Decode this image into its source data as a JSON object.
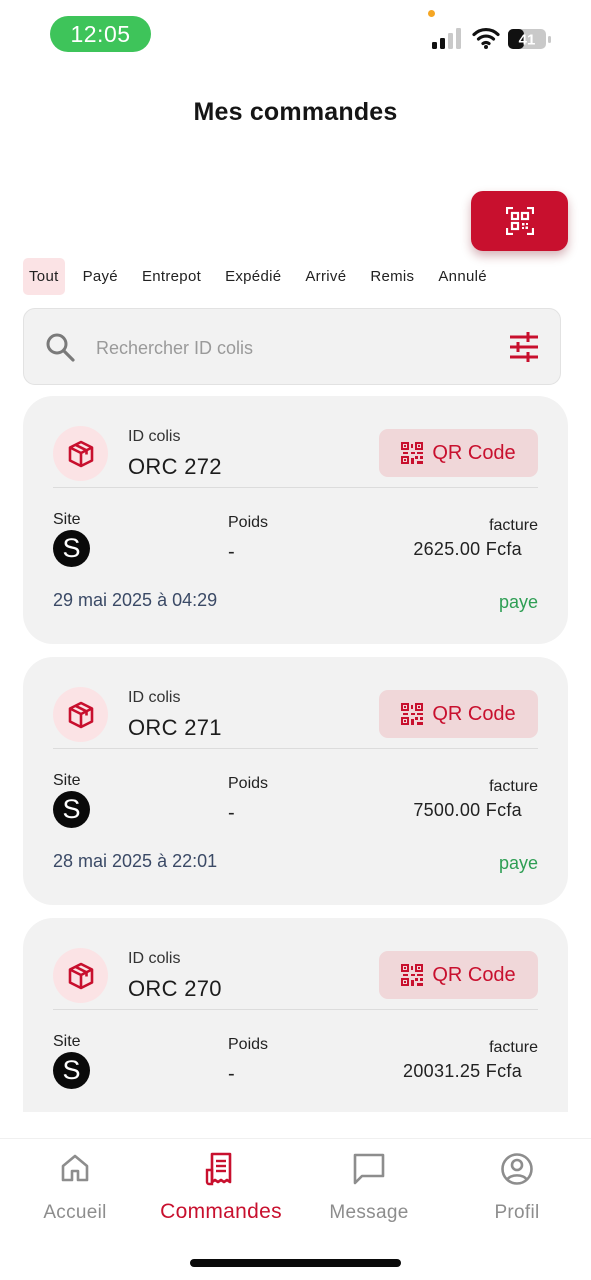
{
  "status_bar": {
    "time": "12:05",
    "battery": "41"
  },
  "header": {
    "title": "Mes commandes"
  },
  "tabs": [
    {
      "label": "Tout",
      "active": true
    },
    {
      "label": "Payé",
      "active": false
    },
    {
      "label": "Entrepot",
      "active": false
    },
    {
      "label": "Expédié",
      "active": false
    },
    {
      "label": "Arrivé",
      "active": false
    },
    {
      "label": "Remis",
      "active": false
    },
    {
      "label": "Annulé",
      "active": false
    }
  ],
  "search": {
    "placeholder": "Rechercher ID colis",
    "value": ""
  },
  "orders": [
    {
      "id_label": "ID colis",
      "id": "ORC 272",
      "qr_label": "QR Code",
      "site_label": "Site",
      "site_logo": "S",
      "poids_label": "Poids",
      "poids": "-",
      "facture_label": "facture",
      "facture": "2625.00 Fcfa",
      "date": "29 mai 2025 à 04:29",
      "status": "paye"
    },
    {
      "id_label": "ID colis",
      "id": "ORC 271",
      "qr_label": "QR Code",
      "site_label": "Site",
      "site_logo": "S",
      "poids_label": "Poids",
      "poids": "-",
      "facture_label": "facture",
      "facture": "7500.00 Fcfa",
      "date": "28 mai 2025 à 22:01",
      "status": "paye"
    },
    {
      "id_label": "ID colis",
      "id": "ORC 270",
      "qr_label": "QR Code",
      "site_label": "Site",
      "site_logo": "S",
      "poids_label": "Poids",
      "poids": "-",
      "facture_label": "facture",
      "facture": "20031.25 Fcfa",
      "date": "",
      "status": ""
    }
  ],
  "bottom_nav": [
    {
      "label": "Accueil",
      "icon": "home-icon",
      "active": false
    },
    {
      "label": "Commandes",
      "icon": "receipt-icon",
      "active": true
    },
    {
      "label": "Message",
      "icon": "message-icon",
      "active": false
    },
    {
      "label": "Profil",
      "icon": "profile-icon",
      "active": false
    }
  ],
  "colors": {
    "accent": "#c8102e",
    "accent_light": "#fbe3e5",
    "status_paid": "#2e9e54",
    "card_bg": "#f2f2f2",
    "time_pill": "#3ec45a"
  }
}
